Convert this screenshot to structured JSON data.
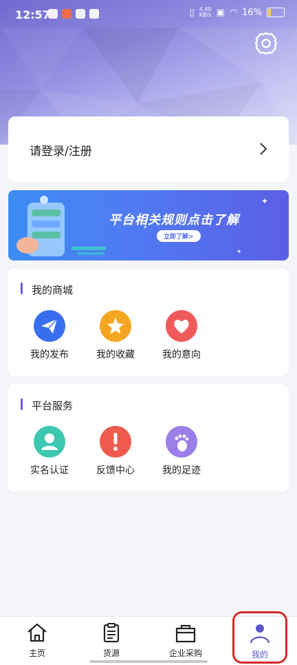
{
  "status_bar": {
    "time": "12:57",
    "net_speed_value": "4.40",
    "net_speed_unit": "KB/s",
    "battery": "16%"
  },
  "header": {
    "settings_icon": "gear-icon"
  },
  "login": {
    "label": "请登录/注册",
    "icon": "chevron-right-icon"
  },
  "banner": {
    "title": "平台相关规则点击了解",
    "button": "立即了解>"
  },
  "my_mall": {
    "title": "我的商城",
    "items": [
      {
        "label": "我的发布",
        "icon": "paper-plane-icon",
        "color": "#3a6ef0"
      },
      {
        "label": "我的收藏",
        "icon": "star-icon",
        "color": "#f5a623"
      },
      {
        "label": "我的意向",
        "icon": "heart-icon",
        "color": "#ef5a5a"
      }
    ]
  },
  "platform_service": {
    "title": "平台服务",
    "items": [
      {
        "label": "实名认证",
        "icon": "user-verify-icon",
        "color": "#3cc8b0"
      },
      {
        "label": "反馈中心",
        "icon": "exclamation-icon",
        "color": "#ee5b4e"
      },
      {
        "label": "我的足迹",
        "icon": "footprint-icon",
        "color": "#9b7ee8"
      }
    ]
  },
  "tabbar": {
    "tabs": [
      {
        "label": "主页",
        "icon": "home-icon"
      },
      {
        "label": "货源",
        "icon": "clipboard-icon"
      },
      {
        "label": "企业采购",
        "icon": "shopping-bag-icon"
      },
      {
        "label": "我的",
        "icon": "person-icon",
        "active": true
      }
    ],
    "accent": "#5b55c9"
  }
}
